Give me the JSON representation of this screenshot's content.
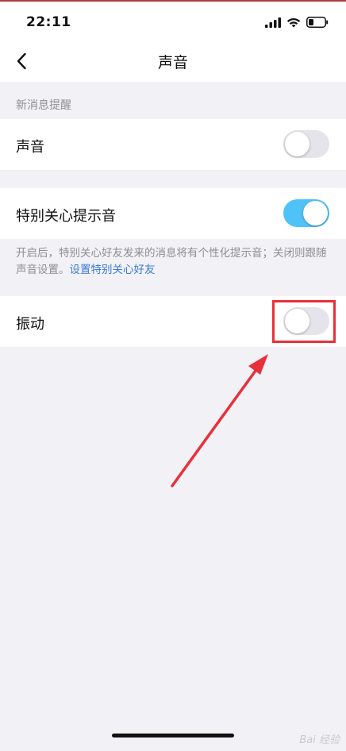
{
  "status_bar": {
    "time": "22:11"
  },
  "nav": {
    "title": "声音"
  },
  "section": {
    "new_message_header": "新消息提醒"
  },
  "settings": {
    "sound": {
      "label": "声音",
      "enabled": false
    },
    "special_care_sound": {
      "label": "特别关心提示音",
      "enabled": true
    },
    "vibration": {
      "label": "振动",
      "enabled": false
    }
  },
  "hint": {
    "text": "开启后，特别关心好友发来的消息将有个性化提示音；关闭则跟随声音设置。",
    "link": "设置特别关心好友"
  },
  "watermark": "Bai 经验",
  "colors": {
    "accent_toggle_on": "#4fc3f7",
    "link": "#3a7bd5",
    "annotation": "#e8303a"
  }
}
